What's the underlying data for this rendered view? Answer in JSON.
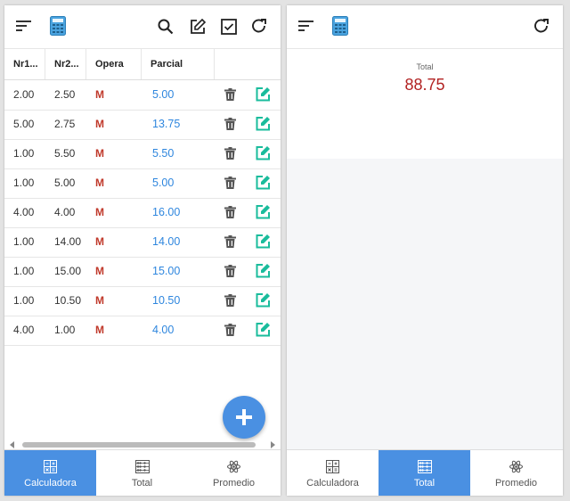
{
  "left": {
    "table": {
      "headers": [
        "Nr1...",
        "Nr2...",
        "Opera",
        "Parcial"
      ],
      "rows": [
        {
          "nr1": "2.00",
          "nr2": "2.50",
          "op": "M",
          "parcial": "5.00"
        },
        {
          "nr1": "5.00",
          "nr2": "2.75",
          "op": "M",
          "parcial": "13.75"
        },
        {
          "nr1": "1.00",
          "nr2": "5.50",
          "op": "M",
          "parcial": "5.50"
        },
        {
          "nr1": "1.00",
          "nr2": "5.00",
          "op": "M",
          "parcial": "5.00"
        },
        {
          "nr1": "4.00",
          "nr2": "4.00",
          "op": "M",
          "parcial": "16.00"
        },
        {
          "nr1": "1.00",
          "nr2": "14.00",
          "op": "M",
          "parcial": "14.00"
        },
        {
          "nr1": "1.00",
          "nr2": "15.00",
          "op": "M",
          "parcial": "15.00"
        },
        {
          "nr1": "1.00",
          "nr2": "10.50",
          "op": "M",
          "parcial": "10.50"
        },
        {
          "nr1": "4.00",
          "nr2": "1.00",
          "op": "M",
          "parcial": "4.00"
        }
      ]
    },
    "nav": [
      {
        "label": "Calculadora",
        "icon": "calculator-icon",
        "active": true
      },
      {
        "label": "Total",
        "icon": "abacus-icon",
        "active": false
      },
      {
        "label": "Promedio",
        "icon": "atom-icon",
        "active": false
      }
    ]
  },
  "right": {
    "total_label": "Total",
    "total_value": "88.75",
    "nav": [
      {
        "label": "Calculadora",
        "icon": "calculator-icon",
        "active": false
      },
      {
        "label": "Total",
        "icon": "abacus-icon",
        "active": true
      },
      {
        "label": "Promedio",
        "icon": "atom-icon",
        "active": false
      }
    ]
  },
  "colors": {
    "accent": "#4a90e2",
    "operation": "#c0392b",
    "parcial": "#2e86de",
    "total": "#b22222",
    "edit": "#1abc9c"
  }
}
